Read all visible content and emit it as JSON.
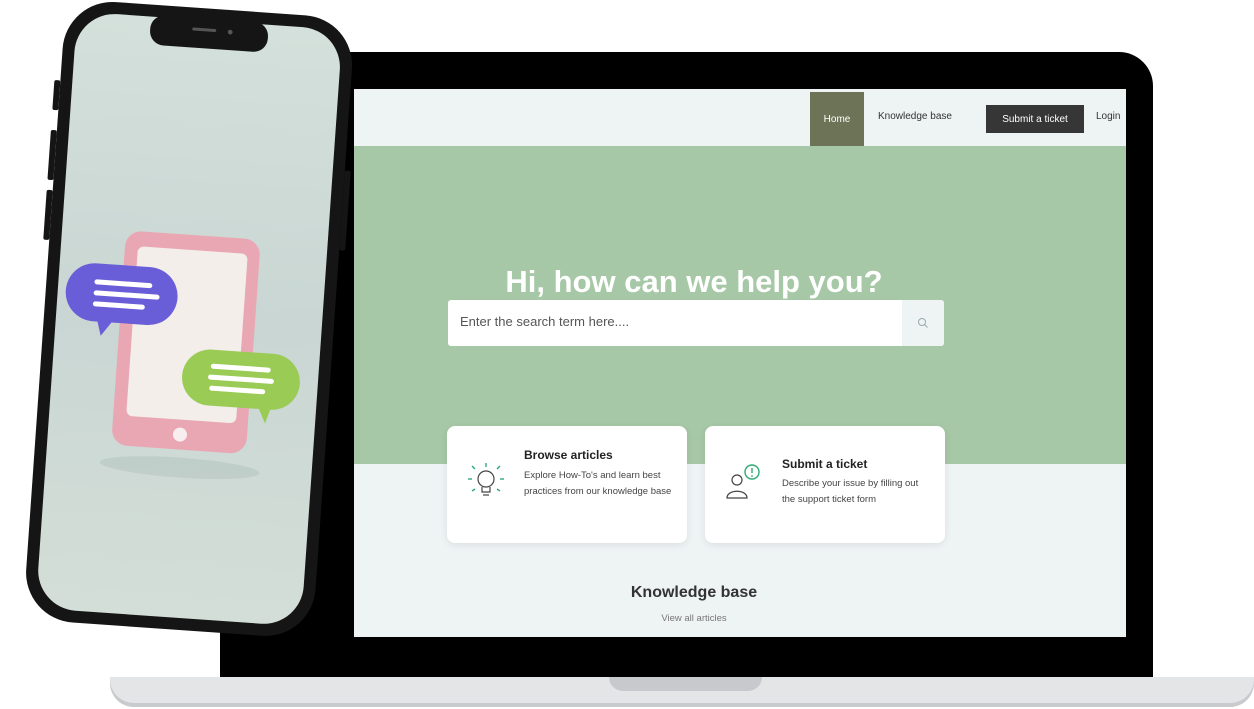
{
  "nav": {
    "home": "Home",
    "knowledge_base": "Knowledge base",
    "submit_ticket": "Submit a ticket",
    "login": "Login"
  },
  "hero": {
    "title": "Hi, how can we help you?",
    "search_placeholder": "Enter the search term here...."
  },
  "cards": [
    {
      "title": "Browse articles",
      "description": "Explore How-To's and learn best practices from our knowledge base",
      "icon": "lightbulb-icon"
    },
    {
      "title": "Submit a ticket",
      "description": "Describe your issue by filling out the support ticket form",
      "icon": "user-alert-icon"
    }
  ],
  "knowledge_base": {
    "title": "Knowledge base",
    "link": "View all articles"
  },
  "colors": {
    "hero_bg": "#a6c8a6",
    "nav_home_bg": "#6c7357",
    "nav_submit_bg": "#363636",
    "page_bg": "#eef3f4",
    "icon_accent": "#2faa74"
  }
}
